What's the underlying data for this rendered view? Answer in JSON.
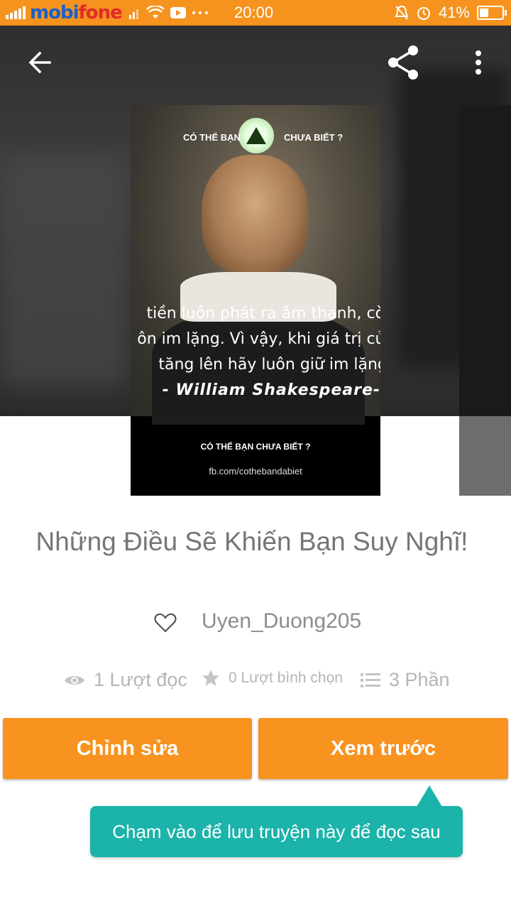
{
  "status_bar": {
    "carrier_part1": "mobi",
    "carrier_part2": "fone",
    "time": "20:00",
    "battery_text": "41%",
    "battery_level": 0.41,
    "icons": [
      "signal-icon",
      "wifi-icon",
      "youtube-icon",
      "more-dots-icon",
      "alarm-off-icon",
      "alarm-clock-icon",
      "battery-icon"
    ]
  },
  "toolbar": {
    "back_icon": "back-arrow-icon",
    "share_icon": "share-icon",
    "more_icon": "more-vertical-icon"
  },
  "cover": {
    "tag_left": "CÓ THỂ BẠN",
    "tag_right": "CHƯA BIẾT ?",
    "quote_line1": "tiền luôn phát ra âm thanh, còn",
    "quote_line2": "ôn im lặng. Vì vậy, khi giá trị của",
    "quote_line3": "tăng lên hãy luôn giữ im lặng\"",
    "quote_author": "- William Shakespeare-",
    "footer_title": "CÓ THỂ BẠN CHƯA BIẾT ?",
    "footer_url": "fb.com/cothebandabiet"
  },
  "story": {
    "title": "Những Điều Sẽ Khiến Bạn Suy Nghĩ!",
    "author": "Uyen_Duong205",
    "views": "1 Lượt đọc",
    "votes": "0 Lượt bình chọn",
    "parts": "3 Phần"
  },
  "actions": {
    "edit_label": "Chỉnh sửa",
    "preview_label": "Xem trước"
  },
  "tooltip": {
    "text": "Chạm vào để lưu truyện này để đọc sau"
  },
  "colors": {
    "accent": "#f7931e",
    "tooltip": "#1bb3aa",
    "status_bar": "#f5931e"
  }
}
